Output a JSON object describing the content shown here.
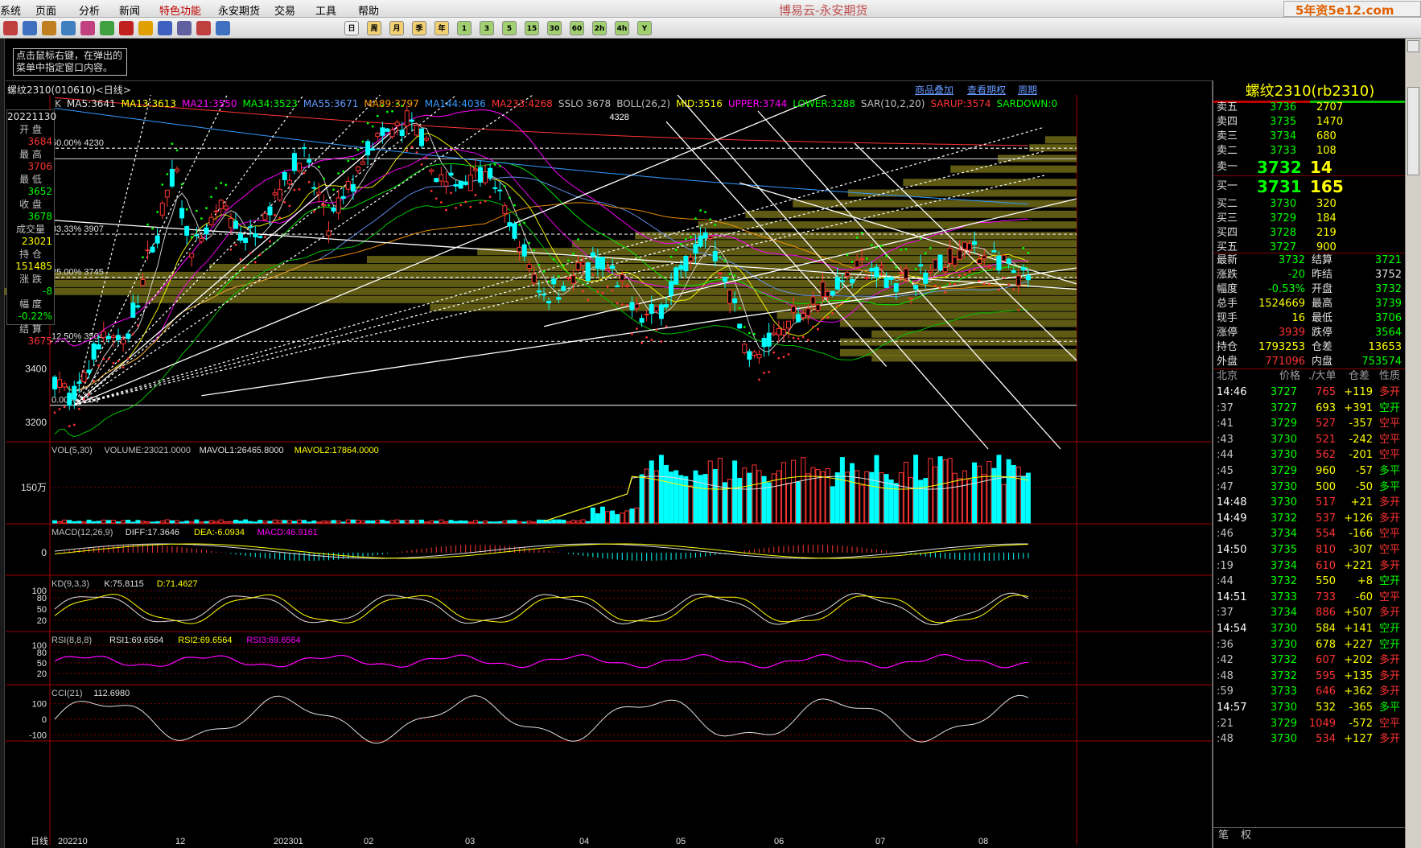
{
  "menu": [
    "系统",
    "页面",
    "分析",
    "新闻",
    "特色功能",
    "永安期货",
    "交易",
    "工具",
    "帮助"
  ],
  "menu_highlight_index": 4,
  "app_title": "博易云-永安期货",
  "window_overlay_text": "5年资5e12.com",
  "toolbar_period_labels": [
    "日",
    "周",
    "月",
    "季",
    "年",
    "1",
    "3",
    "5",
    "15",
    "30",
    "60",
    "2h",
    "4h",
    "Y"
  ],
  "tip_text": [
    "点击鼠标右键，在弹出的",
    "菜单中指定窗口内容。"
  ],
  "chart_title": "螺纹2310(010610)<日线>",
  "header_links": [
    "商品叠加",
    "查看期权",
    "周期"
  ],
  "ma_line": [
    {
      "t": "K",
      "c": "#c0c0c0"
    },
    {
      "t": "MA5:3641",
      "c": "#e0e0e0"
    },
    {
      "t": "MA13:3613",
      "c": "#ffff00"
    },
    {
      "t": "MA21:3550",
      "c": "#ff00ff"
    },
    {
      "t": "MA34:3523",
      "c": "#00ff00"
    },
    {
      "t": "MA55:3671",
      "c": "#6699ff"
    },
    {
      "t": "MA89:3797",
      "c": "#ff9900"
    },
    {
      "t": "MA144:4036",
      "c": "#3399ff"
    },
    {
      "t": "MA233:4268",
      "c": "#ff3333"
    },
    {
      "t": "SSLO 3678",
      "c": "#c0c0c0"
    },
    {
      "t": "BOLL(26,2)",
      "c": "#c0c0c0"
    },
    {
      "t": "MID:3516",
      "c": "#ffff00"
    },
    {
      "t": "UPPER:3744",
      "c": "#ff00ff"
    },
    {
      "t": "LOWER:3288",
      "c": "#00ff00"
    },
    {
      "t": "SAR(10,2,20)",
      "c": "#c0c0c0"
    },
    {
      "t": "SARUP:3574",
      "c": "#ff3333"
    },
    {
      "t": "SARDOWN:0",
      "c": "#00ff00"
    }
  ],
  "daily_box": [
    {
      "label": "20221130",
      "value": ""
    },
    {
      "label": "开 盘",
      "value": "3684"
    },
    {
      "label": "最 高",
      "value": "3706"
    },
    {
      "label": "最 低",
      "value": "3652"
    },
    {
      "label": "收 盘",
      "value": "3678"
    },
    {
      "label": "成交量",
      "value": "23021"
    },
    {
      "label": "持 仓",
      "value": "151485"
    },
    {
      "label": "涨 跌",
      "value": "-8"
    },
    {
      "label": "幅 度",
      "value": "-0.22%"
    },
    {
      "label": "结 算",
      "value": "3675"
    }
  ],
  "fib_labels": [
    {
      "t": "50.00%  4230",
      "v": 4230
    },
    {
      "t": "33.33%  3907",
      "v": 3907
    },
    {
      "t": "25.00%  3745",
      "v": 3745
    },
    {
      "t": "12.50%  3504",
      "v": 3504
    },
    {
      "t": "0.00%  3264",
      "v": 3264
    }
  ],
  "peak_label": "4328",
  "y_ticks": [
    "3600",
    "3400",
    "3200"
  ],
  "x_labels": [
    "日线",
    "202210",
    "12",
    "202301",
    "02",
    "03",
    "04",
    "05",
    "06",
    "07",
    "08"
  ],
  "vol_header": [
    {
      "t": "VOL(5,30)",
      "c": "#c0c0c0"
    },
    {
      "t": "VOLUME:23021.0000",
      "c": "#c0c0c0"
    },
    {
      "t": "MAVOL1:26465.8000",
      "c": "#e0e0e0"
    },
    {
      "t": "MAVOL2:17864.0000",
      "c": "#ffff00"
    }
  ],
  "vol_tick": "150万",
  "macd_header": [
    {
      "t": "MACD(12,26,9)",
      "c": "#c0c0c0"
    },
    {
      "t": "DIFF:17.3646",
      "c": "#e0e0e0"
    },
    {
      "t": "DEA:-6.0934",
      "c": "#ffff00"
    },
    {
      "t": "MACD:46.9161",
      "c": "#ff00ff"
    }
  ],
  "macd_tick": "0",
  "kd_header": [
    {
      "t": "KD(9,3,3)",
      "c": "#c0c0c0"
    },
    {
      "t": "K:75.8115",
      "c": "#e0e0e0"
    },
    {
      "t": "D:71.4627",
      "c": "#ffff00"
    }
  ],
  "kd_ticks": [
    "100",
    "80",
    "50",
    "20"
  ],
  "rsi_header": [
    {
      "t": "RSI(8,8,8)",
      "c": "#c0c0c0"
    },
    {
      "t": "RSI1:69.6564",
      "c": "#e0e0e0"
    },
    {
      "t": "RSI2:69.6564",
      "c": "#ffff00"
    },
    {
      "t": "RSI3:69.6564",
      "c": "#ff00ff"
    }
  ],
  "rsi_ticks": [
    "100",
    "80",
    "50",
    "20"
  ],
  "cci_header": [
    {
      "t": "CCI(21)",
      "c": "#c0c0c0"
    },
    {
      "t": "112.6980",
      "c": "#e0e0e0"
    }
  ],
  "cci_ticks": [
    "100",
    "0",
    "-100"
  ],
  "quote": {
    "title": "螺纹2310(rb2310)",
    "asks": [
      {
        "label": "卖五",
        "price": "3736",
        "vol": "2707"
      },
      {
        "label": "卖四",
        "price": "3735",
        "vol": "1470"
      },
      {
        "label": "卖三",
        "price": "3734",
        "vol": "680"
      },
      {
        "label": "卖二",
        "price": "3733",
        "vol": "108"
      },
      {
        "label": "卖一",
        "price": "3732",
        "vol": "14"
      }
    ],
    "bids": [
      {
        "label": "买一",
        "price": "3731",
        "vol": "165"
      },
      {
        "label": "买二",
        "price": "3730",
        "vol": "320"
      },
      {
        "label": "买三",
        "price": "3729",
        "vol": "184"
      },
      {
        "label": "买四",
        "price": "3728",
        "vol": "219"
      },
      {
        "label": "买五",
        "price": "3727",
        "vol": "900"
      }
    ],
    "stats": [
      {
        "l1": "最新",
        "v1": "3732",
        "c1": "#00ff00",
        "l2": "结算",
        "v2": "3721",
        "c2": "#00ff00"
      },
      {
        "l1": "涨跌",
        "v1": "-20",
        "c1": "#00ff00",
        "l2": "昨结",
        "v2": "3752",
        "c2": "#e0e0e0"
      },
      {
        "l1": "幅度",
        "v1": "-0.53%",
        "c1": "#00ff00",
        "l2": "开盘",
        "v2": "3732",
        "c2": "#00ff00"
      },
      {
        "l1": "总手",
        "v1": "1524669",
        "c1": "#ffff00",
        "l2": "最高",
        "v2": "3739",
        "c2": "#00ff00"
      },
      {
        "l1": "现手",
        "v1": "16",
        "c1": "#ffff00",
        "l2": "最低",
        "v2": "3706",
        "c2": "#00ff00"
      },
      {
        "l1": "涨停",
        "v1": "3939",
        "c1": "#ff3333",
        "l2": "跌停",
        "v2": "3564",
        "c2": "#00ff00"
      },
      {
        "l1": "持仓",
        "v1": "1793253",
        "c1": "#ffff00",
        "l2": "仓差",
        "v2": "13653",
        "c2": "#ffff00"
      },
      {
        "l1": "外盘",
        "v1": "771096",
        "c1": "#ff3333",
        "l2": "内盘",
        "v2": "753574",
        "c2": "#00ff00"
      }
    ],
    "tick_header": [
      "北京",
      "价格",
      "./大单",
      "仓差",
      "性质"
    ],
    "ticks": [
      {
        "time": "14:46",
        "price": "3727",
        "vol": "765",
        "oi": "+119",
        "type": "多开",
        "vc": "#ff3333",
        "tc": "#ff3333"
      },
      {
        "time": ":37",
        "price": "3727",
        "vol": "693",
        "oi": "+391",
        "type": "空开",
        "vc": "#ffff00",
        "tc": "#00ff00"
      },
      {
        "time": ":41",
        "price": "3729",
        "vol": "527",
        "oi": "-357",
        "type": "空平",
        "vc": "#ff3333",
        "tc": "#ff3333"
      },
      {
        "time": ":43",
        "price": "3730",
        "vol": "521",
        "oi": "-242",
        "type": "空平",
        "vc": "#ff3333",
        "tc": "#ff3333"
      },
      {
        "time": ":44",
        "price": "3730",
        "vol": "562",
        "oi": "-201",
        "type": "空平",
        "vc": "#ff3333",
        "tc": "#ff3333"
      },
      {
        "time": ":45",
        "price": "3729",
        "vol": "960",
        "oi": "-57",
        "type": "多平",
        "vc": "#ffff00",
        "tc": "#00ff00"
      },
      {
        "time": ":47",
        "price": "3730",
        "vol": "500",
        "oi": "-50",
        "type": "多平",
        "vc": "#ffff00",
        "tc": "#00ff00"
      },
      {
        "time": "14:48",
        "price": "3730",
        "vol": "517",
        "oi": "+21",
        "type": "多开",
        "vc": "#ff3333",
        "tc": "#ff3333"
      },
      {
        "time": "14:49",
        "price": "3732",
        "vol": "537",
        "oi": "+126",
        "type": "多开",
        "vc": "#ff3333",
        "tc": "#ff3333"
      },
      {
        "time": ":46",
        "price": "3734",
        "vol": "554",
        "oi": "-166",
        "type": "空平",
        "vc": "#ff3333",
        "tc": "#ff3333"
      },
      {
        "time": "14:50",
        "price": "3735",
        "vol": "810",
        "oi": "-307",
        "type": "空平",
        "vc": "#ff3333",
        "tc": "#ff3333"
      },
      {
        "time": ":19",
        "price": "3734",
        "vol": "610",
        "oi": "+221",
        "type": "多开",
        "vc": "#ff3333",
        "tc": "#ff3333"
      },
      {
        "time": ":44",
        "price": "3732",
        "vol": "550",
        "oi": "+8",
        "type": "空开",
        "vc": "#ffff00",
        "tc": "#00ff00"
      },
      {
        "time": "14:51",
        "price": "3733",
        "vol": "733",
        "oi": "-60",
        "type": "空平",
        "vc": "#ff3333",
        "tc": "#ff3333"
      },
      {
        "time": ":37",
        "price": "3734",
        "vol": "886",
        "oi": "+507",
        "type": "多开",
        "vc": "#ff3333",
        "tc": "#ff3333"
      },
      {
        "time": "14:54",
        "price": "3730",
        "vol": "584",
        "oi": "+141",
        "type": "空开",
        "vc": "#ffff00",
        "tc": "#00ff00"
      },
      {
        "time": ":36",
        "price": "3730",
        "vol": "678",
        "oi": "+227",
        "type": "空开",
        "vc": "#ffff00",
        "tc": "#00ff00"
      },
      {
        "time": ":42",
        "price": "3732",
        "vol": "607",
        "oi": "+202",
        "type": "多开",
        "vc": "#ff3333",
        "tc": "#ff3333"
      },
      {
        "time": ":48",
        "price": "3732",
        "vol": "595",
        "oi": "+135",
        "type": "多开",
        "vc": "#ff3333",
        "tc": "#ff3333"
      },
      {
        "time": ":59",
        "price": "3733",
        "vol": "646",
        "oi": "+362",
        "type": "多开",
        "vc": "#ff3333",
        "tc": "#ff3333"
      },
      {
        "time": "14:57",
        "price": "3730",
        "vol": "532",
        "oi": "-365",
        "type": "多平",
        "vc": "#ffff00",
        "tc": "#00ff00"
      },
      {
        "time": ":21",
        "price": "3729",
        "vol": "1049",
        "oi": "-572",
        "type": "空平",
        "vc": "#ff3333",
        "tc": "#ff3333"
      },
      {
        "time": ":48",
        "price": "3730",
        "vol": "534",
        "oi": "+127",
        "type": "多开",
        "vc": "#ff3333",
        "tc": "#ff3333"
      }
    ],
    "bottom_tabs": [
      "笔",
      "权"
    ]
  },
  "colors": {
    "up": "#ff3333",
    "down": "#00ffff",
    "ma5": "#e0e0e0",
    "ma13": "#ffff00",
    "ma21": "#ff00ff",
    "ma34": "#00ff00",
    "ma55": "#6699ff",
    "ma89": "#ff9900",
    "ma144": "#3399ff",
    "ma233": "#ff3333",
    "profile": "#6e6a18"
  }
}
